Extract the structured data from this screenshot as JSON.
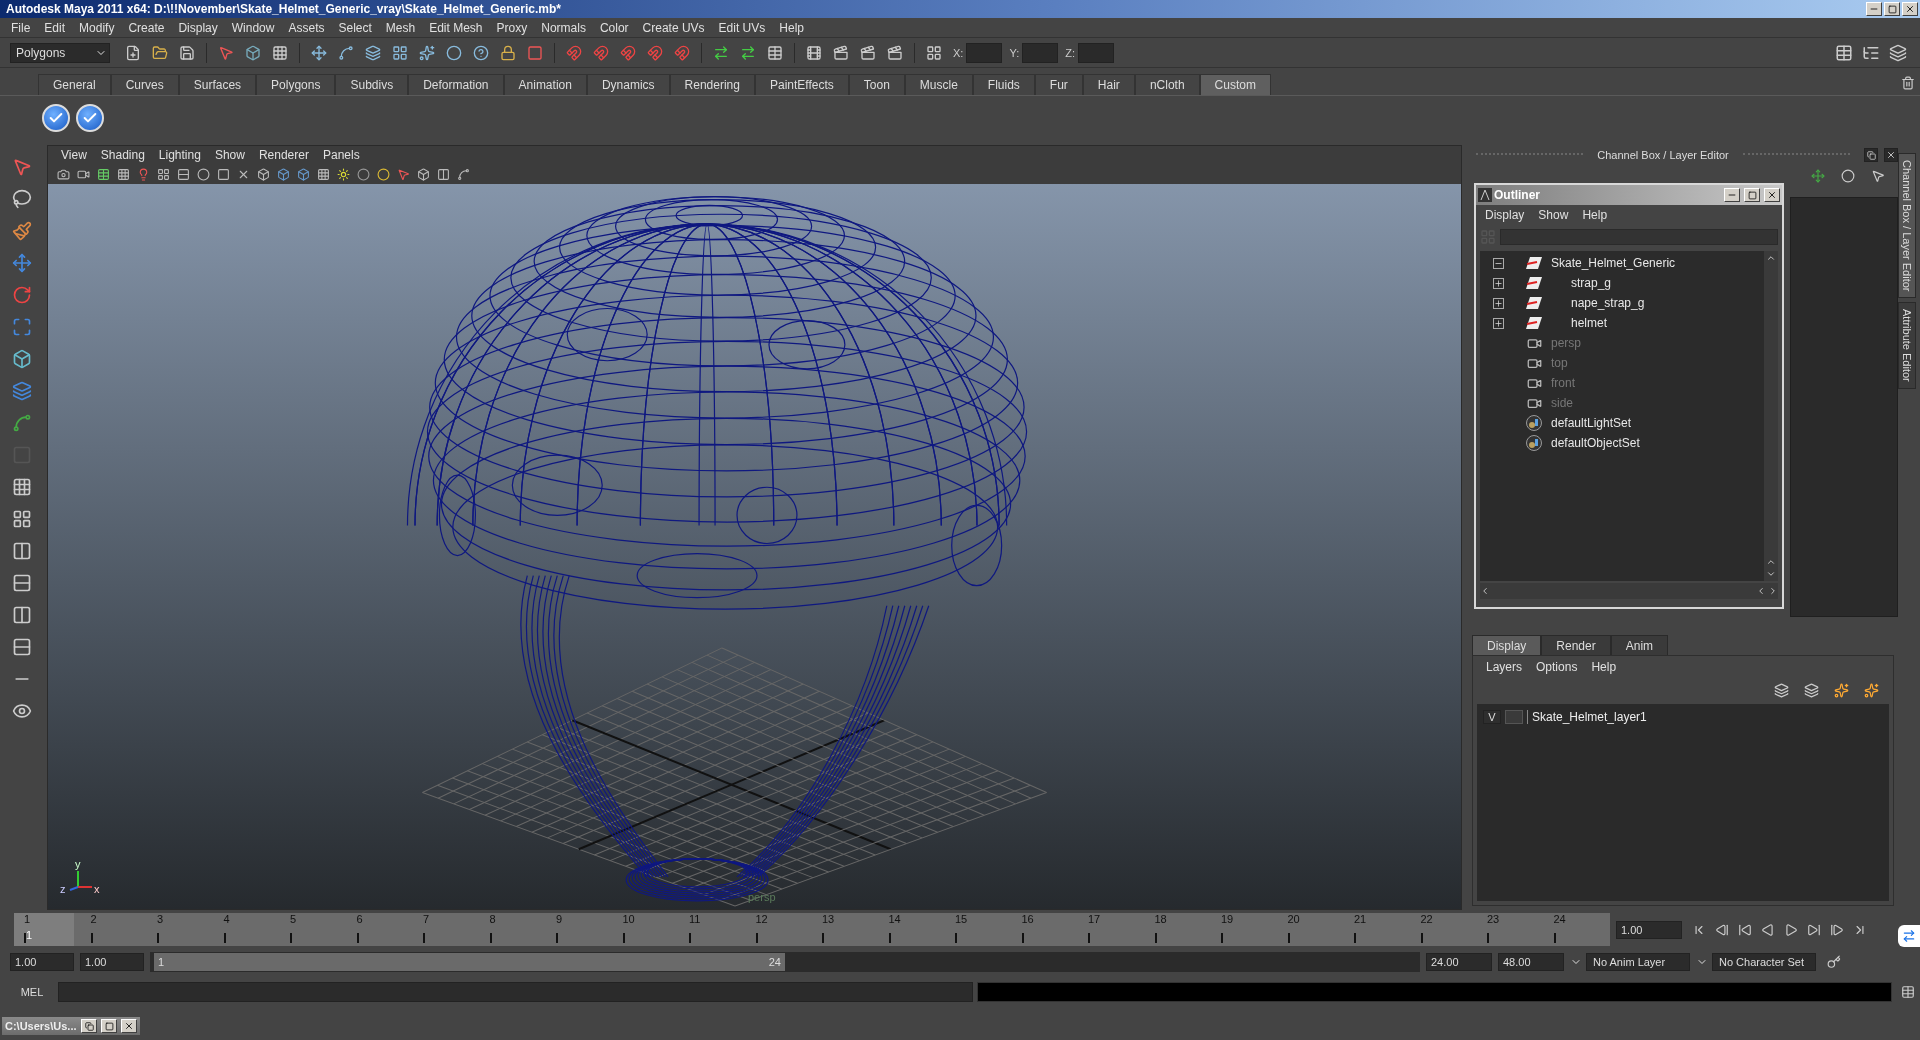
{
  "window": {
    "title": "Autodesk Maya 2011 x64: D:\\!!November\\Skate_Helmet_Generic_vray\\Skate_Helmet_Generic.mb*"
  },
  "menu": [
    "File",
    "Edit",
    "Modify",
    "Create",
    "Display",
    "Window",
    "Assets",
    "Select",
    "Mesh",
    "Edit Mesh",
    "Proxy",
    "Normals",
    "Color",
    "Create UVs",
    "Edit UVs",
    "Help"
  ],
  "toolbar": {
    "mode": "Polygons",
    "x_label": "X:",
    "y_label": "Y:",
    "z_label": "Z:"
  },
  "shelf_tabs": [
    {
      "label": "General",
      "selected": false
    },
    {
      "label": "Curves",
      "selected": false
    },
    {
      "label": "Surfaces",
      "selected": false
    },
    {
      "label": "Polygons",
      "selected": false
    },
    {
      "label": "Subdivs",
      "selected": false
    },
    {
      "label": "Deformation",
      "selected": false
    },
    {
      "label": "Animation",
      "selected": false
    },
    {
      "label": "Dynamics",
      "selected": false
    },
    {
      "label": "Rendering",
      "selected": false
    },
    {
      "label": "PaintEffects",
      "selected": false
    },
    {
      "label": "Toon",
      "selected": false
    },
    {
      "label": "Muscle",
      "selected": false
    },
    {
      "label": "Fluids",
      "selected": false
    },
    {
      "label": "Fur",
      "selected": false
    },
    {
      "label": "Hair",
      "selected": false
    },
    {
      "label": "nCloth",
      "selected": false
    },
    {
      "label": "Custom",
      "selected": true
    }
  ],
  "viewport": {
    "menu": [
      "View",
      "Shading",
      "Lighting",
      "Show",
      "Renderer",
      "Panels"
    ],
    "axis_y": "y",
    "axis_z": "z",
    "axis_x": "x",
    "camera_label": "persp"
  },
  "channel_box": {
    "title": "Channel Box / Layer Editor"
  },
  "side_tabs": [
    {
      "label": "Channel Box / Layer Editor",
      "selected": true
    },
    {
      "label": "Attribute Editor",
      "selected": false
    }
  ],
  "outliner": {
    "title": "Outliner",
    "menu": [
      "Display",
      "Show",
      "Help"
    ],
    "items": [
      {
        "label": "Skate_Helmet_Generic",
        "kind": "transform",
        "dimmed": false,
        "expanded": true,
        "children": [
          {
            "label": "strap_g",
            "kind": "transform",
            "dimmed": false,
            "expanded": false
          },
          {
            "label": "nape_strap_g",
            "kind": "transform",
            "dimmed": false,
            "expanded": false
          },
          {
            "label": "helmet",
            "kind": "transform",
            "dimmed": false,
            "expanded": false
          }
        ]
      },
      {
        "label": "persp",
        "kind": "camera",
        "dimmed": true
      },
      {
        "label": "top",
        "kind": "camera",
        "dimmed": true
      },
      {
        "label": "front",
        "kind": "camera",
        "dimmed": true
      },
      {
        "label": "side",
        "kind": "camera",
        "dimmed": true
      },
      {
        "label": "defaultLightSet",
        "kind": "set",
        "dimmed": false
      },
      {
        "label": "defaultObjectSet",
        "kind": "set",
        "dimmed": false
      }
    ]
  },
  "layer_editor": {
    "tabs": [
      {
        "label": "Display",
        "selected": true
      },
      {
        "label": "Render",
        "selected": false
      },
      {
        "label": "Anim",
        "selected": false
      }
    ],
    "menu": [
      "Layers",
      "Options",
      "Help"
    ],
    "layers": [
      {
        "flag": "V",
        "name": "Skate_Helmet_layer1"
      }
    ]
  },
  "timeline": {
    "frames": [
      {
        "label": "1",
        "selected": true
      },
      {
        "label": "2",
        "selected": false
      },
      {
        "label": "3",
        "selected": false
      },
      {
        "label": "4",
        "selected": false
      },
      {
        "label": "5",
        "selected": false
      },
      {
        "label": "6",
        "selected": false
      },
      {
        "label": "7",
        "selected": false
      },
      {
        "label": "8",
        "selected": false
      },
      {
        "label": "9",
        "selected": false
      },
      {
        "label": "10",
        "selected": false
      },
      {
        "label": "11",
        "selected": false
      },
      {
        "label": "12",
        "selected": false
      },
      {
        "label": "13",
        "selected": false
      },
      {
        "label": "14",
        "selected": false
      },
      {
        "label": "15",
        "selected": false
      },
      {
        "label": "16",
        "selected": false
      },
      {
        "label": "17",
        "selected": false
      },
      {
        "label": "18",
        "selected": false
      },
      {
        "label": "19",
        "selected": false
      },
      {
        "label": "20",
        "selected": false
      },
      {
        "label": "21",
        "selected": false
      },
      {
        "label": "22",
        "selected": false
      },
      {
        "label": "23",
        "selected": false
      },
      {
        "label": "24",
        "selected": false
      }
    ],
    "current_marker": "1",
    "current_frame": "1.00"
  },
  "range": {
    "start": "1.00",
    "playback_start": "1.00",
    "slider_start": "1",
    "slider_end": "24",
    "level": 0.5,
    "playback_end": "24.00",
    "end": "48.00",
    "anim_layer": "No Anim Layer",
    "character_set": "No Character Set"
  },
  "command_line": {
    "label": "MEL"
  },
  "taskbar": {
    "title": "C:\\Users\\Us..."
  }
}
